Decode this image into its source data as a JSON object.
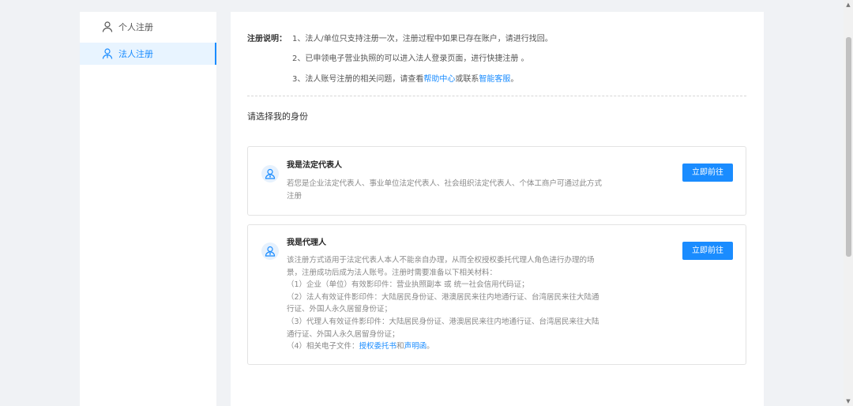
{
  "sidebar": {
    "items": [
      {
        "label": "个人注册",
        "icon": "user-icon",
        "active": false
      },
      {
        "label": "法人注册",
        "icon": "legal-person-icon",
        "active": true
      }
    ]
  },
  "notice": {
    "title": "注册说明：",
    "line1": "1、法人/单位只支持注册一次，注册过程中如果已存在账户，请进行找回。",
    "line2": "2、已申领电子营业执照的可以进入法人登录页面，进行快捷注册 。",
    "line3_prefix": "3、法人账号注册的相关问题，请查看",
    "line3_link1": "帮助中心",
    "line3_mid": "或联系",
    "line3_link2": "智能客服",
    "line3_suffix": "。"
  },
  "section_title": "请选择我的身份",
  "cards": {
    "legal_rep": {
      "title": "我是法定代表人",
      "desc_line1": "若您是企业法定代表人、事业单位法定代表人、社会组织法定代表人、个体工商户可通过此方式",
      "desc_line2": "注册",
      "button": "立即前往"
    },
    "agent": {
      "title": "我是代理人",
      "desc_lines": [
        "该注册方式适用于法定代表人本人不能亲自办理，从而全权授权委托代理人角色进行办理的场",
        "景，注册成功后成为法人账号。注册时需要准备以下相关材料：",
        "（1）企业（单位）有效影印件：营业执照副本 或 统一社会信用代码证；",
        "（2）法人有效证件影印件：大陆居民身份证、港澳居民来往内地通行证、台湾居民来往大陆通",
        "行证、外国人永久居留身份证；",
        "（3）代理人有效证件影印件：大陆居民身份证、港澳居民来往内地通行证、台湾居民来往大陆",
        "通行证、外国人永久居留身份证；"
      ],
      "last_prefix": "（4）相关电子文件：",
      "last_link1": "授权委托书",
      "last_mid": "和",
      "last_link2": "声明函",
      "last_suffix": "。",
      "button": "立即前往"
    }
  },
  "colors": {
    "accent": "#1a8cff",
    "page_bg": "#f0f2f5",
    "active_bg": "#e8f4ff"
  }
}
